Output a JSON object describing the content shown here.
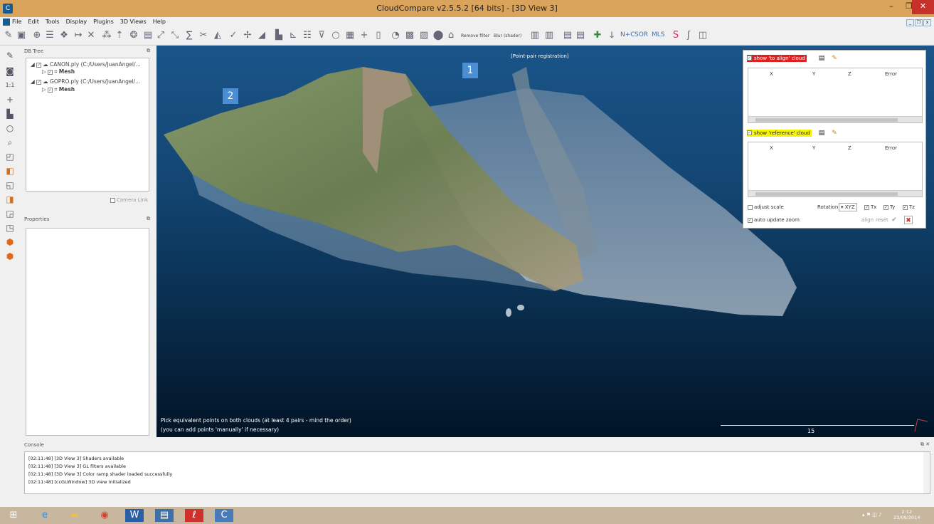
{
  "window": {
    "title": "CloudCompare v2.5.5.2 [64 bits] - [3D View 3]",
    "min_label": "–",
    "max_label": "❐",
    "close_label": "✕"
  },
  "menu": [
    "File",
    "Edit",
    "Tools",
    "Display",
    "Plugins",
    "3D Views",
    "Help"
  ],
  "toolbar": {
    "remove_filter": "Remove filter",
    "blur_shader": "Blur (shader)",
    "nfc": "N+C",
    "sor": "SOR",
    "mls": "MLS"
  },
  "db_tree": {
    "title": "DB Tree",
    "items": [
      {
        "label": "CANON.ply (C:/Users/JuanAngel/...",
        "child": "Mesh"
      },
      {
        "label": "GOPRO.ply (C:/Users/JuanAngel/...",
        "child": "Mesh"
      }
    ],
    "camera_link": "Camera Link"
  },
  "properties": {
    "title": "Properties"
  },
  "view": {
    "mode_label": "[Point-pair registration]",
    "marker1": "1",
    "marker2": "2",
    "hint1": "Pick equivalent points on both clouds (at least 4 pairs - mind the order)",
    "hint2": "(you can add points 'manually' if necessary)",
    "scale_value": "15"
  },
  "registration": {
    "to_align_label": "show 'to align' cloud",
    "to_align_color": "#e02020",
    "reference_label": "show 'reference' cloud",
    "reference_color": "#f5f500",
    "columns": [
      "X",
      "Y",
      "Z",
      "Error"
    ],
    "adjust_scale": "adjust scale",
    "rotation_label": "Rotation",
    "rotation_value": "XYZ",
    "tx": "Tx",
    "ty": "Ty",
    "tz": "Tz",
    "auto_update_zoom": "auto update zoom",
    "align": "align",
    "reset": "reset"
  },
  "console": {
    "title": "Console",
    "lines": [
      "[02:11:48] [3D View 3] Shaders available",
      "[02:11:48] [3D View 3] GL filters available",
      "[02:11:48] [3D View 3] Color ramp shader loaded successfully",
      "[02:11:48] [ccGLWindow] 3D view initialized"
    ]
  },
  "taskbar": {
    "time": "2:12",
    "date": "23/09/2014"
  }
}
